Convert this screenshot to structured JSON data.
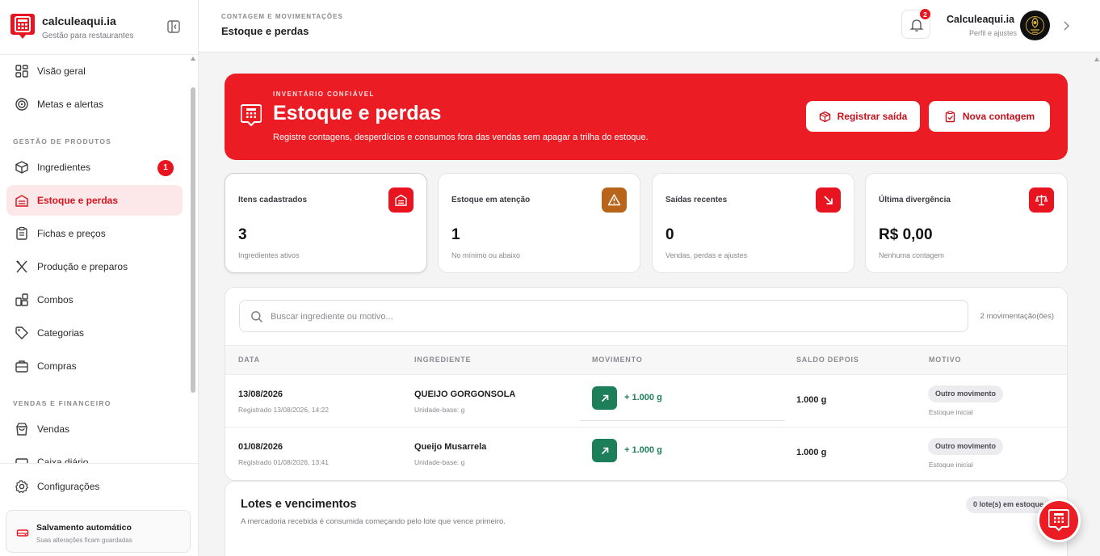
{
  "brand": {
    "name": "calculeaqui.ia",
    "subtitle": "Gestão para restaurantes"
  },
  "sidebar": {
    "items": [
      {
        "label": "Visão geral",
        "icon": "grid-icon"
      },
      {
        "label": "Metas e alertas",
        "icon": "target-icon"
      },
      {
        "label": "Ingredientes",
        "icon": "box-icon",
        "badge": "1"
      },
      {
        "label": "Estoque e perdas",
        "icon": "warehouse-icon",
        "active": true
      },
      {
        "label": "Fichas e preços",
        "icon": "clipboard-icon"
      },
      {
        "label": "Produção e preparos",
        "icon": "utensils-icon"
      },
      {
        "label": "Combos",
        "icon": "combo-icon"
      },
      {
        "label": "Categorias",
        "icon": "tag-icon"
      },
      {
        "label": "Compras",
        "icon": "briefcase-icon"
      },
      {
        "label": "Vendas",
        "icon": "bag-icon"
      },
      {
        "label": "Caixa diário",
        "icon": "cash-icon"
      }
    ],
    "sections": {
      "products": "GESTÃO DE PRODUTOS",
      "sales": "VENDAS E FINANCEIRO"
    },
    "settings": "Configurações",
    "autosave": {
      "title": "Salvamento automático",
      "subtitle": "Suas alterações ficam guardadas"
    }
  },
  "header": {
    "breadcrumb": "CONTAGEM E MOVIMENTAÇÕES",
    "title": "Estoque e perdas",
    "notifications": "2",
    "user_name": "Calculeaqui.ia",
    "user_sub": "Perfil e ajustes"
  },
  "hero": {
    "eyebrow": "INVENTÁRIO CONFIÁVEL",
    "title": "Estoque e perdas",
    "subtitle": "Registre contagens, desperdícios e consumos fora das vendas sem apagar a trilha do estoque.",
    "btn_saida": "Registrar saída",
    "btn_contagem": "Nova contagem"
  },
  "stats": [
    {
      "label": "Itens cadastrados",
      "value": "3",
      "sub": "Ingredientes ativos",
      "icon": "warehouse-icon",
      "color": "#e8141f"
    },
    {
      "label": "Estoque em atenção",
      "value": "1",
      "sub": "No mínimo ou abaixo",
      "icon": "warning-icon",
      "color": "#b8641a"
    },
    {
      "label": "Saídas recentes",
      "value": "0",
      "sub": "Vendas, perdas e ajustes",
      "icon": "arrow-down-right-icon",
      "color": "#e8141f"
    },
    {
      "label": "Última divergência",
      "value": "R$ 0,00",
      "sub": "Nenhuma contagem",
      "icon": "scale-icon",
      "color": "#e8141f"
    }
  ],
  "movements": {
    "search_placeholder": "Buscar ingrediente ou motivo...",
    "count": "2 movimentação(ões)",
    "columns": [
      "DATA",
      "INGREDIENTE",
      "MOVIMENTO",
      "SALDO DEPOIS",
      "MOTIVO"
    ],
    "rows": [
      {
        "date": "13/08/2026",
        "registered": "Registrado 13/08/2026, 14:22",
        "ingredient": "QUEIJO GORGONSOLA",
        "unit": "Unidade-base: g",
        "movement": "+ 1.000 g",
        "balance": "1.000 g",
        "reason": "Outro movimento",
        "reason_sub": "Estoque inicial"
      },
      {
        "date": "01/08/2026",
        "registered": "Registrado 01/08/2026, 13:41",
        "ingredient": "Queijo Musarrela",
        "unit": "Unidade-base: g",
        "movement": "+ 1.000 g",
        "balance": "1.000 g",
        "reason": "Outro movimento",
        "reason_sub": "Estoque inicial"
      }
    ]
  },
  "lotes": {
    "title": "Lotes e vencimentos",
    "subtitle": "A mercadoria recebida é consumida começando pelo lote que vence primeiro.",
    "badge": "0 lote(s) em estoque"
  },
  "colors": {
    "accent": "#ec1c24",
    "positive": "#1d7f5a",
    "warning": "#b8641a"
  }
}
